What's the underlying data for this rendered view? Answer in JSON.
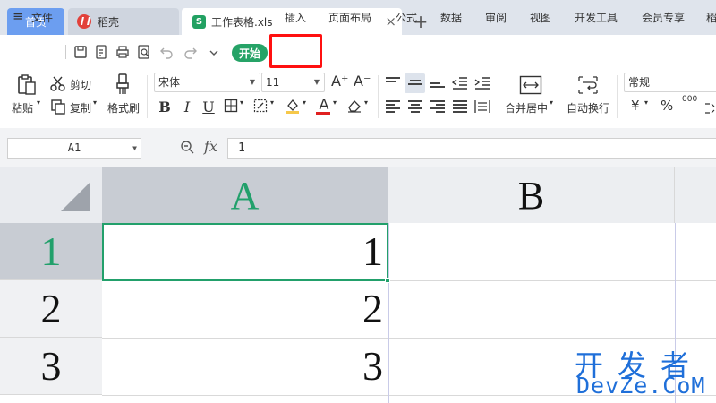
{
  "tabs": {
    "home": "首页",
    "doke": "稻壳",
    "file": "工作表格.xls",
    "file_icon": "S",
    "close": "×",
    "add": "+"
  },
  "menu": {
    "file": "文件",
    "hamburger": "≡",
    "start": "开始",
    "items": [
      "插入",
      "页面布局",
      "公式",
      "数据",
      "审阅",
      "视图",
      "开发工具",
      "会员专享",
      "稻"
    ]
  },
  "ribbon": {
    "paste": "粘贴",
    "cut": "剪切",
    "copy": "复制",
    "format_painter": "格式刷",
    "font_name": "宋体",
    "font_size": "11",
    "merge_center": "合并居中",
    "wrap_text": "自动换行",
    "number_format": "常规",
    "currency": "¥",
    "percent": "%",
    "thousands": "000",
    "grow_font": "A⁺",
    "shrink_font": "A⁻"
  },
  "formula_bar": {
    "name_box": "A1",
    "fx": "fx",
    "value": "1"
  },
  "grid": {
    "columns": [
      "A",
      "B"
    ],
    "rows": [
      "1",
      "2",
      "3"
    ],
    "values": [
      "1",
      "2",
      "3"
    ]
  },
  "watermark": {
    "cn": "开发者",
    "en": "DevZe.CoM"
  },
  "colors": {
    "accent_green": "#22a06b",
    "highlight_red": "#ff1010",
    "home_tab_blue": "#6c9ef0"
  }
}
